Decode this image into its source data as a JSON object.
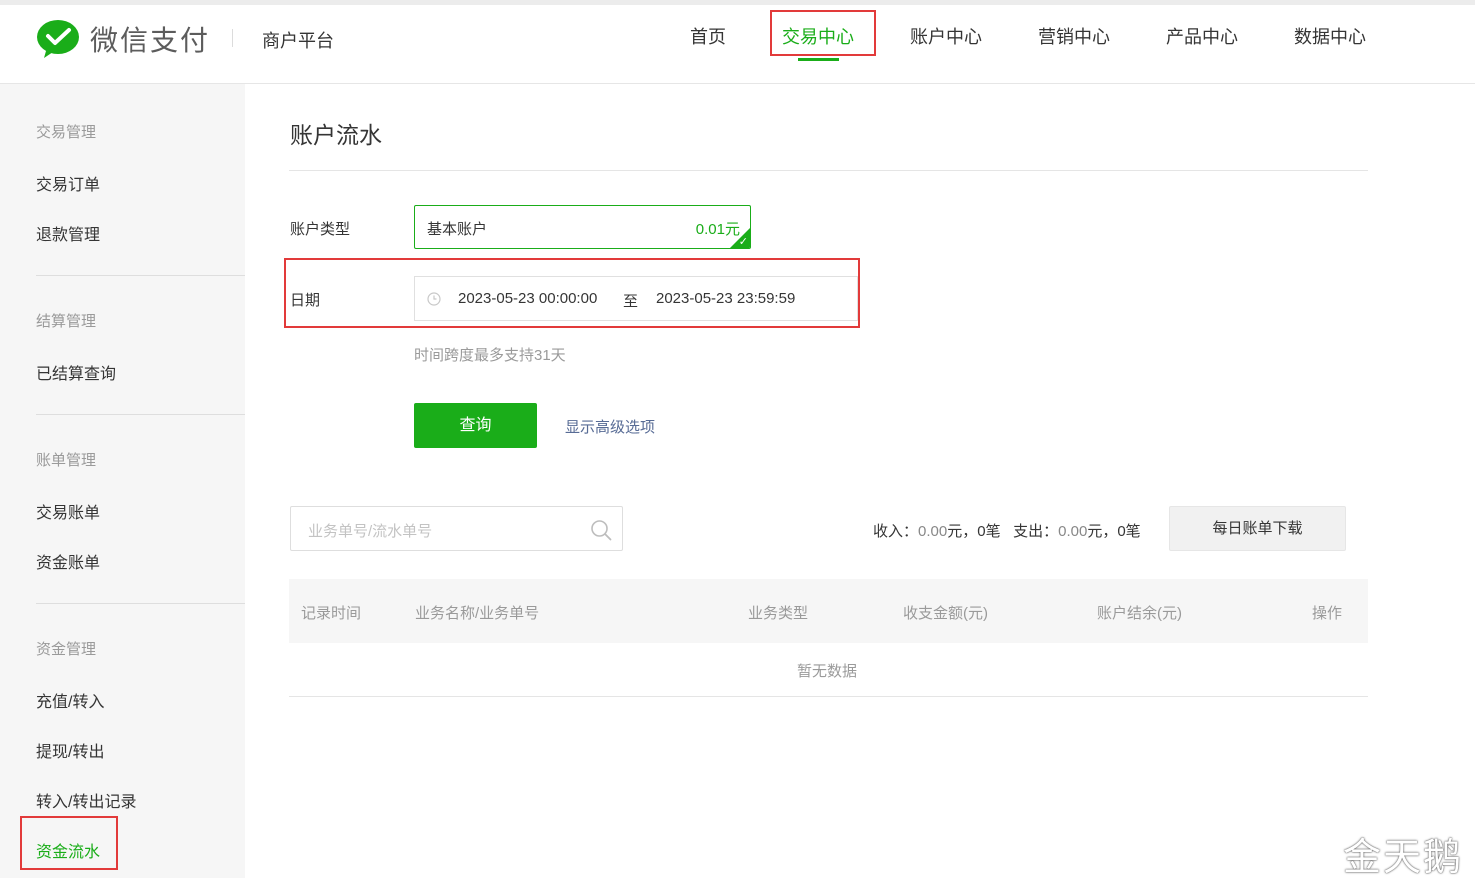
{
  "header": {
    "logo_text": "微信支付",
    "platform": "商户平台",
    "nav": [
      "首页",
      "交易中心",
      "账户中心",
      "营销中心",
      "产品中心",
      "数据中心"
    ],
    "active_nav": "交易中心",
    "accent_color": "#1aad19"
  },
  "sidebar": {
    "groups": [
      {
        "title": "交易管理",
        "items": [
          "交易订单",
          "退款管理"
        ]
      },
      {
        "title": "结算管理",
        "items": [
          "已结算查询"
        ]
      },
      {
        "title": "账单管理",
        "items": [
          "交易账单",
          "资金账单"
        ]
      },
      {
        "title": "资金管理",
        "items": [
          "充值/转入",
          "提现/转出",
          "转入/转出记录",
          "资金流水"
        ]
      }
    ],
    "active_item": "资金流水"
  },
  "main": {
    "title": "账户流水",
    "account_type_label": "账户类型",
    "account_name": "基本账户",
    "account_amount": "0.01元",
    "date_label": "日期",
    "date_start": "2023-05-23 00:00:00",
    "date_to": "至",
    "date_end": "2023-05-23 23:59:59",
    "hint": "时间跨度最多支持31天",
    "query_button": "查询",
    "advanced_link": "显示高级选项",
    "search_placeholder": "业务单号/流水单号",
    "summary": {
      "income_label": "收入：",
      "income_amount": "0.00",
      "income_unit": "元，",
      "income_count": "0笔",
      "expense_label": "支出：",
      "expense_amount": "0.00",
      "expense_unit": "元，",
      "expense_count": "0笔"
    },
    "download_button": "每日账单下载",
    "table_headers": [
      "记录时间",
      "业务名称/业务单号",
      "业务类型",
      "收支金额(元)",
      "账户结余(元)",
      "操作"
    ],
    "empty_text": "暂无数据"
  },
  "watermark": "金天鹅"
}
